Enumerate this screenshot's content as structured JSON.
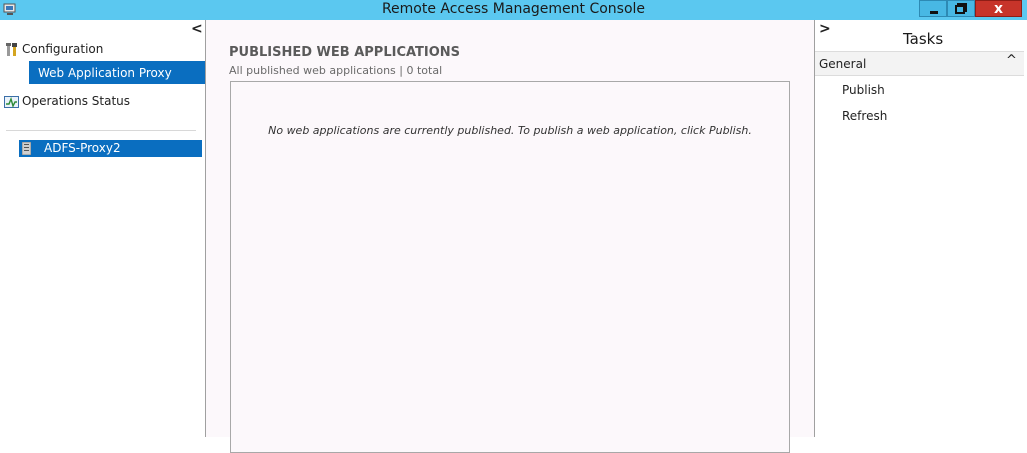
{
  "window": {
    "title": "Remote Access Management Console",
    "close_glyph": "x",
    "title_bar_color": "#5bc8f0",
    "close_button_color": "#c7342a"
  },
  "nav": {
    "collapse_glyph": "<",
    "items": [
      {
        "label": "Configuration",
        "icon": "wrench-screwdriver-icon"
      },
      {
        "label": "Web Application Proxy",
        "selected": true
      },
      {
        "label": "Operations Status",
        "icon": "status-monitor-icon"
      }
    ],
    "server": {
      "label": "ADFS-Proxy2",
      "icon": "server-icon"
    },
    "selection_color": "#0a6ec0"
  },
  "main": {
    "title": "PUBLISHED WEB APPLICATIONS",
    "subtitle": "All published web applications | 0 total",
    "empty_message": "No web applications are currently published. To publish a web application, click Publish."
  },
  "tasks": {
    "expand_glyph": ">",
    "title": "Tasks",
    "section": "General",
    "section_chevron": "^",
    "items": [
      {
        "label": "Publish"
      },
      {
        "label": "Refresh"
      }
    ]
  }
}
